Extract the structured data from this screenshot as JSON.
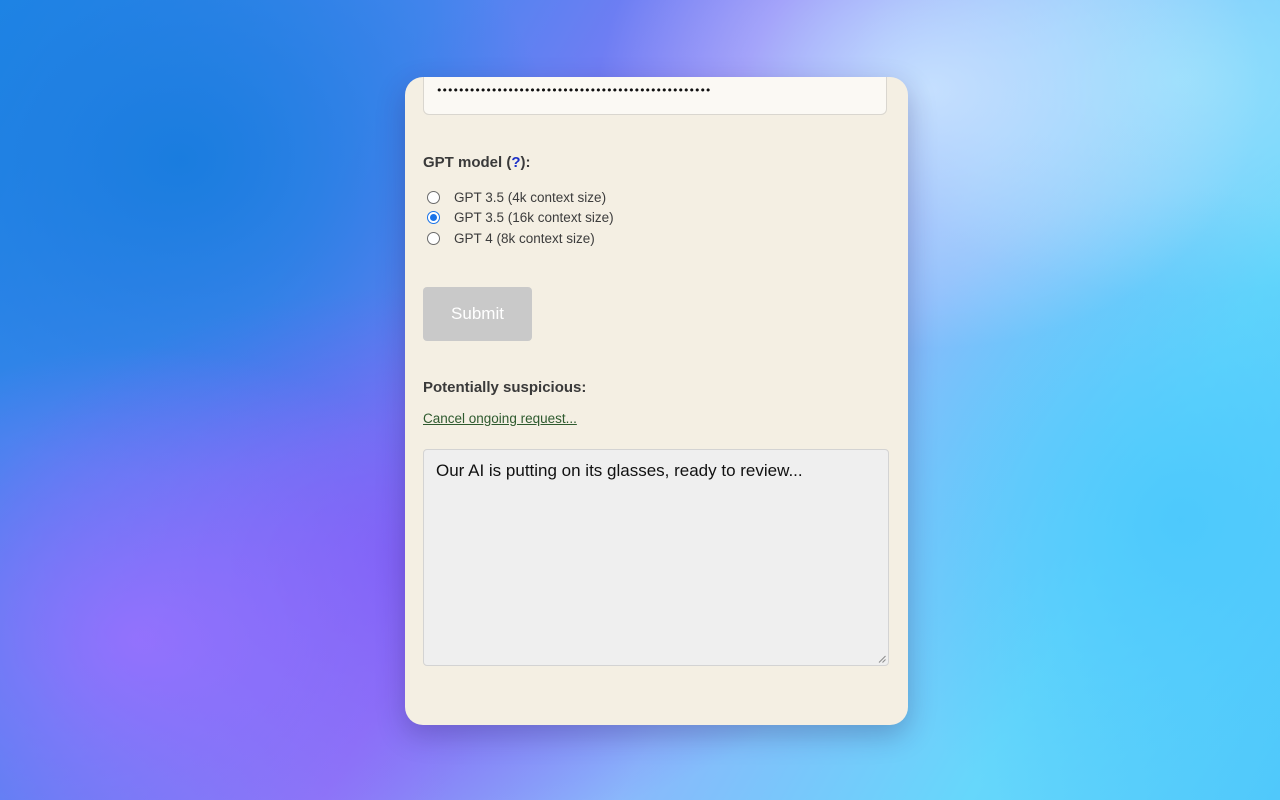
{
  "api_key": {
    "masked_value": "••••••••••••••••••••••••••••••••••••••••••••••••••"
  },
  "model_section": {
    "label_prefix": "GPT model (",
    "help_text": "?",
    "label_suffix": "):",
    "options": [
      {
        "label": "GPT 3.5 (4k context size)",
        "selected": false
      },
      {
        "label": "GPT 3.5 (16k context size)",
        "selected": true
      },
      {
        "label": "GPT 4 (8k context size)",
        "selected": false
      }
    ]
  },
  "submit": {
    "label": "Submit"
  },
  "result_section": {
    "label": "Potentially suspicious:",
    "cancel_link": "Cancel ongoing request...",
    "output_text": "Our AI is putting on its glasses, ready to review..."
  },
  "colors": {
    "panel_bg": "#f4efe3",
    "accent": "#1a73e8",
    "submit_disabled": "#c9c9c9",
    "link_green": "#2e5a2e",
    "help_blue": "#1a2fc8"
  }
}
